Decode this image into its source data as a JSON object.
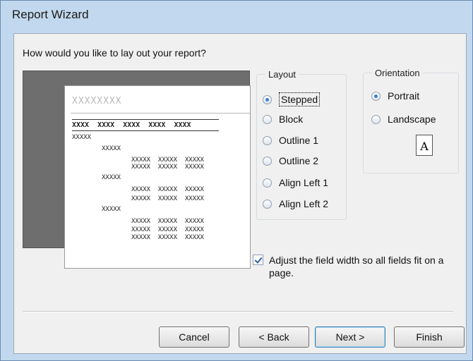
{
  "window": {
    "title": "Report Wizard"
  },
  "question": "How would you like to lay out your report?",
  "preview": {
    "title": "XXXXXXXX",
    "header": "XXXX  XXXX  XXXX  XXXX  XXXX",
    "rows": [
      "XXXXX",
      "XXXXX",
      "XXXXX  XXXXX  XXXXX",
      "XXXXX  XXXXX  XXXXX",
      "XXXXX",
      "XXXXX  XXXXX  XXXXX",
      "XXXXX  XXXXX  XXXXX",
      "XXXXX",
      "XXXXX  XXXXX  XXXXX",
      "XXXXX  XXXXX  XXXXX",
      "XXXXX  XXXXX  XXXXX"
    ]
  },
  "layout": {
    "legend": "Layout",
    "options": [
      {
        "label": "Stepped",
        "selected": true
      },
      {
        "label": "Block",
        "selected": false
      },
      {
        "label": "Outline 1",
        "selected": false
      },
      {
        "label": "Outline 2",
        "selected": false
      },
      {
        "label": "Align Left 1",
        "selected": false
      },
      {
        "label": "Align Left 2",
        "selected": false
      }
    ]
  },
  "orientation": {
    "legend": "Orientation",
    "options": [
      {
        "label": "Portrait",
        "selected": true
      },
      {
        "label": "Landscape",
        "selected": false
      }
    ],
    "icon_letter": "A"
  },
  "adjust": {
    "label": "Adjust the field width so all fields fit on a page.",
    "checked": true
  },
  "buttons": {
    "cancel": "Cancel",
    "back": "< Back",
    "next": "Next >",
    "finish": "Finish"
  }
}
